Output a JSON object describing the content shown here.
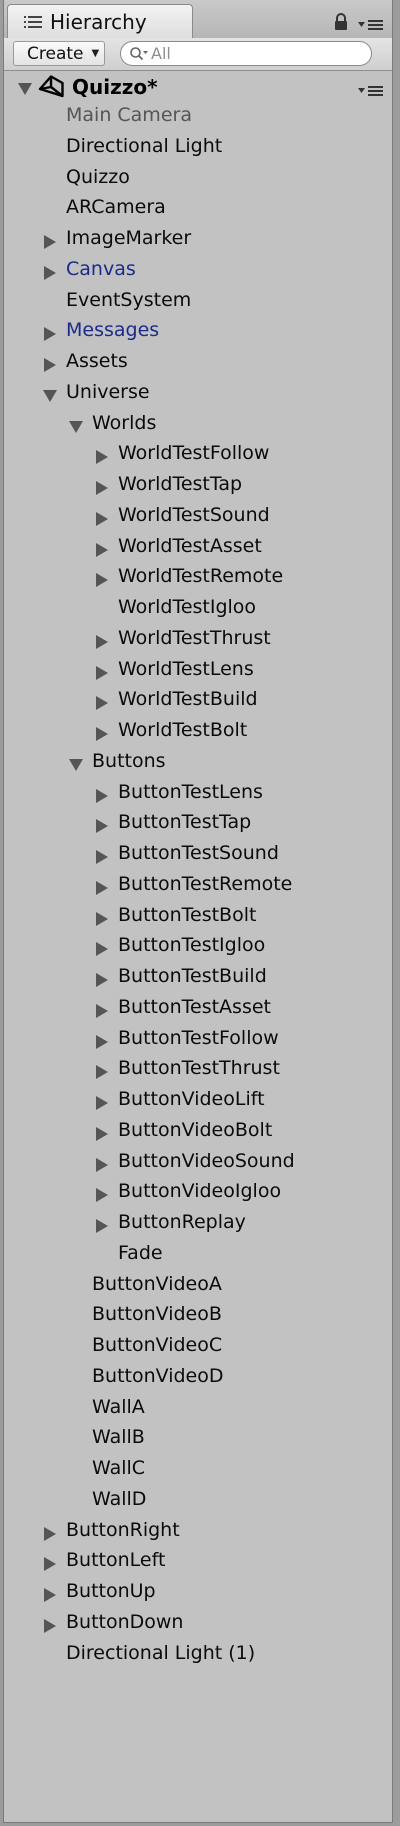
{
  "tab": {
    "title": "Hierarchy"
  },
  "toolbar": {
    "create_label": "Create",
    "search_placeholder": "All"
  },
  "scene": {
    "name": "Quizzo*"
  },
  "items": [
    {
      "label": "Main Camera",
      "depth": 0,
      "arrow": "none",
      "color": "gray"
    },
    {
      "label": "Directional Light",
      "depth": 0,
      "arrow": "none",
      "color": "black"
    },
    {
      "label": "Quizzo",
      "depth": 0,
      "arrow": "none",
      "color": "black"
    },
    {
      "label": "ARCamera",
      "depth": 0,
      "arrow": "none",
      "color": "black"
    },
    {
      "label": "ImageMarker",
      "depth": 0,
      "arrow": "collapsed",
      "color": "black"
    },
    {
      "label": "Canvas",
      "depth": 0,
      "arrow": "collapsed",
      "color": "blue"
    },
    {
      "label": "EventSystem",
      "depth": 0,
      "arrow": "none",
      "color": "black"
    },
    {
      "label": "Messages",
      "depth": 0,
      "arrow": "collapsed",
      "color": "blue"
    },
    {
      "label": "Assets",
      "depth": 0,
      "arrow": "collapsed",
      "color": "black"
    },
    {
      "label": "Universe",
      "depth": 0,
      "arrow": "expanded",
      "color": "black"
    },
    {
      "label": "Worlds",
      "depth": 1,
      "arrow": "expanded",
      "color": "black"
    },
    {
      "label": "WorldTestFollow",
      "depth": 2,
      "arrow": "collapsed",
      "color": "black"
    },
    {
      "label": "WorldTestTap",
      "depth": 2,
      "arrow": "collapsed",
      "color": "black"
    },
    {
      "label": "WorldTestSound",
      "depth": 2,
      "arrow": "collapsed",
      "color": "black"
    },
    {
      "label": "WorldTestAsset",
      "depth": 2,
      "arrow": "collapsed",
      "color": "black"
    },
    {
      "label": "WorldTestRemote",
      "depth": 2,
      "arrow": "collapsed",
      "color": "black"
    },
    {
      "label": "WorldTestIgloo",
      "depth": 2,
      "arrow": "none",
      "color": "black"
    },
    {
      "label": "WorldTestThrust",
      "depth": 2,
      "arrow": "collapsed",
      "color": "black"
    },
    {
      "label": "WorldTestLens",
      "depth": 2,
      "arrow": "collapsed",
      "color": "black"
    },
    {
      "label": "WorldTestBuild",
      "depth": 2,
      "arrow": "collapsed",
      "color": "black"
    },
    {
      "label": "WorldTestBolt",
      "depth": 2,
      "arrow": "collapsed",
      "color": "black"
    },
    {
      "label": "Buttons",
      "depth": 1,
      "arrow": "expanded",
      "color": "black"
    },
    {
      "label": "ButtonTestLens",
      "depth": 2,
      "arrow": "collapsed",
      "color": "black"
    },
    {
      "label": "ButtonTestTap",
      "depth": 2,
      "arrow": "collapsed",
      "color": "black"
    },
    {
      "label": "ButtonTestSound",
      "depth": 2,
      "arrow": "collapsed",
      "color": "black"
    },
    {
      "label": "ButtonTestRemote",
      "depth": 2,
      "arrow": "collapsed",
      "color": "black"
    },
    {
      "label": "ButtonTestBolt",
      "depth": 2,
      "arrow": "collapsed",
      "color": "black"
    },
    {
      "label": "ButtonTestIgloo",
      "depth": 2,
      "arrow": "collapsed",
      "color": "black"
    },
    {
      "label": "ButtonTestBuild",
      "depth": 2,
      "arrow": "collapsed",
      "color": "black"
    },
    {
      "label": "ButtonTestAsset",
      "depth": 2,
      "arrow": "collapsed",
      "color": "black"
    },
    {
      "label": "ButtonTestFollow",
      "depth": 2,
      "arrow": "collapsed",
      "color": "black"
    },
    {
      "label": "ButtonTestThrust",
      "depth": 2,
      "arrow": "collapsed",
      "color": "black"
    },
    {
      "label": "ButtonVideoLift",
      "depth": 2,
      "arrow": "collapsed",
      "color": "black"
    },
    {
      "label": "ButtonVideoBolt",
      "depth": 2,
      "arrow": "collapsed",
      "color": "black"
    },
    {
      "label": "ButtonVideoSound",
      "depth": 2,
      "arrow": "collapsed",
      "color": "black"
    },
    {
      "label": "ButtonVideoIgloo",
      "depth": 2,
      "arrow": "collapsed",
      "color": "black"
    },
    {
      "label": "ButtonReplay",
      "depth": 2,
      "arrow": "collapsed",
      "color": "black"
    },
    {
      "label": "Fade",
      "depth": 2,
      "arrow": "none",
      "color": "black"
    },
    {
      "label": "ButtonVideoA",
      "depth": 1,
      "arrow": "none",
      "color": "black"
    },
    {
      "label": "ButtonVideoB",
      "depth": 1,
      "arrow": "none",
      "color": "black"
    },
    {
      "label": "ButtonVideoC",
      "depth": 1,
      "arrow": "none",
      "color": "black"
    },
    {
      "label": "ButtonVideoD",
      "depth": 1,
      "arrow": "none",
      "color": "black"
    },
    {
      "label": "WallA",
      "depth": 1,
      "arrow": "none",
      "color": "black"
    },
    {
      "label": "WallB",
      "depth": 1,
      "arrow": "none",
      "color": "black"
    },
    {
      "label": "WallC",
      "depth": 1,
      "arrow": "none",
      "color": "black"
    },
    {
      "label": "WallD",
      "depth": 1,
      "arrow": "none",
      "color": "black"
    },
    {
      "label": "ButtonRight",
      "depth": 0,
      "arrow": "collapsed",
      "color": "black"
    },
    {
      "label": "ButtonLeft",
      "depth": 0,
      "arrow": "collapsed",
      "color": "black"
    },
    {
      "label": "ButtonUp",
      "depth": 0,
      "arrow": "collapsed",
      "color": "black"
    },
    {
      "label": "ButtonDown",
      "depth": 0,
      "arrow": "collapsed",
      "color": "black"
    },
    {
      "label": "Directional Light (1)",
      "depth": 0,
      "arrow": "none",
      "color": "black"
    }
  ]
}
